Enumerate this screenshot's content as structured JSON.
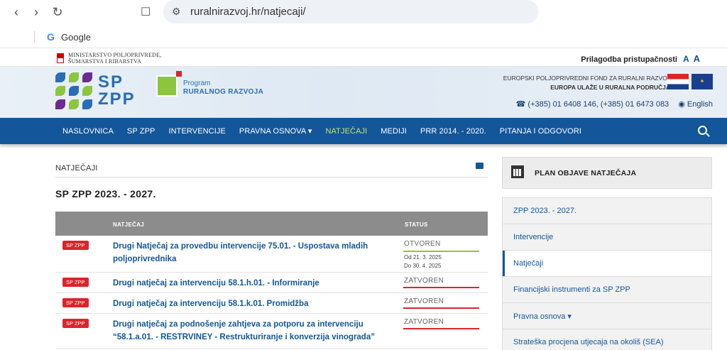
{
  "browser": {
    "url": "ruralnirazvoj.hr/natjecaji/",
    "bookmark_label": "Google"
  },
  "topbar": {
    "ministry_line1": "MINISTARSTVO POLJOPRIVREDE,",
    "ministry_line2": "ŠUMARSTVA I RIBARSTVA",
    "accessibility_label": "Prilagodba pristupačnosti",
    "font_small": "A",
    "font_large": "A"
  },
  "header": {
    "logo_line1": "SP",
    "logo_line2": "ZPP",
    "program_line1": "Program",
    "program_line2": "RURALNOG RAZVOJA",
    "eu_line1": "EUROPSKI POLJOPRIVREDNI FOND ZA RURALNI RAZVOJ",
    "eu_line2": "EUROPA ULAŽE U RURALNA PODRUČJA",
    "phone": "(+385) 01 6408 146, (+385) 01 6473 083",
    "language": "English"
  },
  "nav": {
    "items": [
      {
        "label": "NASLOVNICA"
      },
      {
        "label": "SP ZPP"
      },
      {
        "label": "INTERVENCIJE"
      },
      {
        "label": "PRAVNA OSNOVA ▾"
      },
      {
        "label": "NATJEČAJI"
      },
      {
        "label": "MEDIJI"
      },
      {
        "label": "PRR 2014. - 2020."
      },
      {
        "label": "PITANJA I ODGOVORI"
      }
    ]
  },
  "main": {
    "breadcrumb": "NATJEČAJI",
    "section_title": "SP ZPP 2023. - 2027.",
    "table": {
      "col_natjecaj": "NATJEČAJ",
      "col_status": "STATUS",
      "rows": [
        {
          "badge": "SP ZPP",
          "title": "Drugi Natječaj za provedbu intervencije 75.01. - Uspostava mladih poljoprivrednika",
          "status": "OTVOREN",
          "date_from": "Od 21. 3. 2025",
          "date_to": "Do 30. 4. 2025"
        },
        {
          "badge": "SP ZPP",
          "title": "Drugi natječaj za intervenciju 58.1.h.01. - Informiranje",
          "status": "ZATVOREN"
        },
        {
          "badge": "SP ZPP",
          "title": "Drugi natječaj za intervenciju 58.1.k.01. Promidžba",
          "status": "ZATVOREN"
        },
        {
          "badge": "SP ZPP",
          "title": "Drugi natječaj za podnošenje zahtjeva za potporu za intervenciju “58.1.a.01. - RESTRVINEY - Restrukturiranje i konverzija vinograda”",
          "status": "ZATVOREN"
        }
      ]
    }
  },
  "sidebar": {
    "head_label": "PLAN OBJAVE NATJEČAJA",
    "items": [
      {
        "label": "ZPP 2023. - 2027."
      },
      {
        "label": "Intervencije"
      },
      {
        "label": "Natječaji"
      },
      {
        "label": "Financijski instrumenti za SP ZPP"
      },
      {
        "label": "Pravna osnova ▾"
      },
      {
        "label": "Strateška procjena utjecaja na okoliš (SEA)"
      }
    ]
  },
  "colors": {
    "nav_bg": "#13569a",
    "nav_active": "#c7e36b",
    "badge_red": "#d9262b",
    "open_green": "#9cc03a"
  }
}
